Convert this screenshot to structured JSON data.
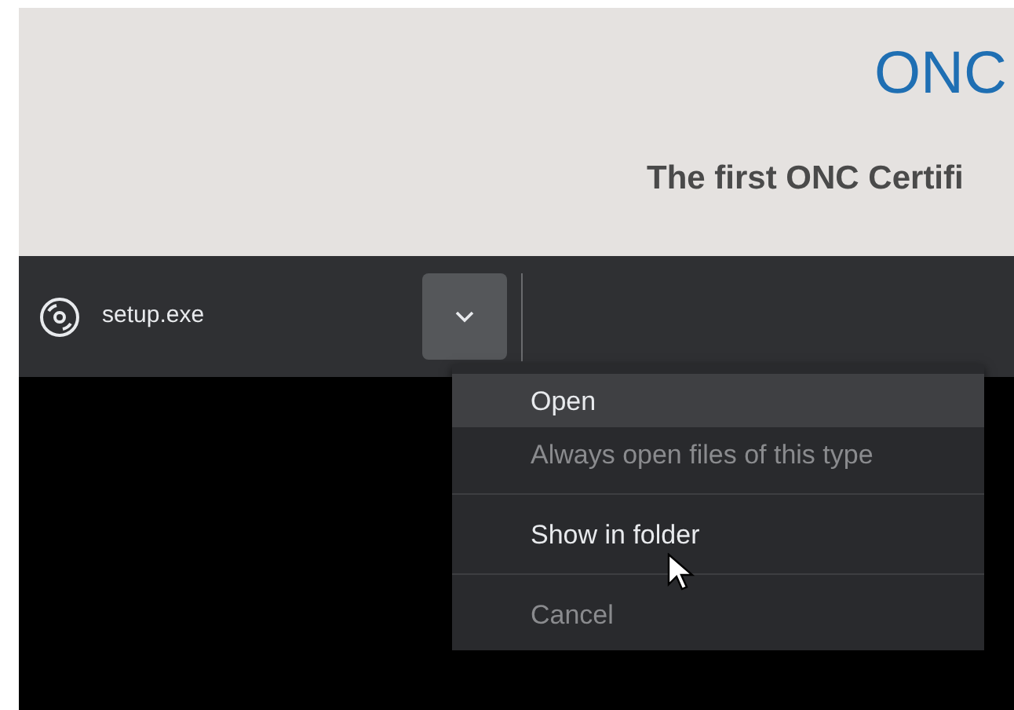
{
  "page": {
    "heading": "ONC",
    "subtitle": "The first ONC Certifi"
  },
  "download_bar": {
    "file_name": "setup.exe",
    "menu_open": true
  },
  "menu": [
    {
      "kind": "item",
      "label": "Open",
      "selected": true,
      "disabled": false
    },
    {
      "kind": "item",
      "label": "Always open files of this type",
      "selected": false,
      "disabled": true
    },
    {
      "kind": "separator"
    },
    {
      "kind": "item",
      "label": "Show in folder",
      "selected": false,
      "disabled": false
    },
    {
      "kind": "separator"
    },
    {
      "kind": "item",
      "label": "Cancel",
      "selected": false,
      "disabled": true
    }
  ]
}
